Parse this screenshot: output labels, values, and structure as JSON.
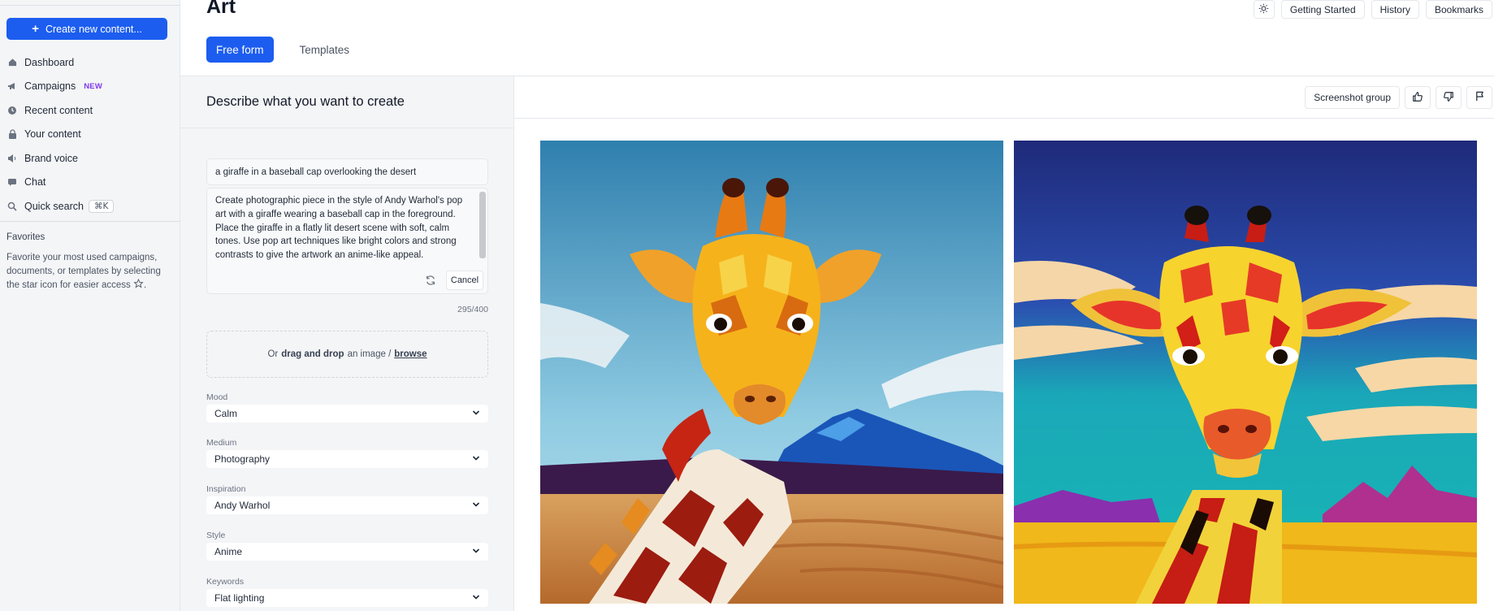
{
  "sidebar": {
    "create_label": "Create new content...",
    "items": [
      {
        "label": "Dashboard",
        "icon": "home-icon"
      },
      {
        "label": "Campaigns",
        "icon": "megaphone-icon",
        "badge": "NEW"
      },
      {
        "label": "Recent content",
        "icon": "clock-icon"
      },
      {
        "label": "Your content",
        "icon": "lock-icon"
      },
      {
        "label": "Brand voice",
        "icon": "speaker-icon"
      },
      {
        "label": "Chat",
        "icon": "chat-icon"
      },
      {
        "label": "Quick search",
        "icon": "search-icon",
        "shortcut": "⌘K"
      }
    ],
    "favorites_title": "Favorites",
    "favorites_text": "Favorite your most used campaigns, documents, or templates by selecting the star icon for easier access"
  },
  "header": {
    "title": "Art",
    "tabs": [
      "Free form",
      "Templates"
    ],
    "actions": [
      "Getting Started",
      "History",
      "Bookmarks"
    ]
  },
  "form": {
    "heading": "Describe what you want to create",
    "prompt": "a giraffe in a baseball cap overlooking the desert",
    "expanded": "Create photographic piece in the style of Andy Warhol's pop art with a giraffe wearing a baseball cap in the foreground. Place the giraffe in a flatly lit desert scene with soft, calm tones. Use pop art techniques like bright colors and strong contrasts to give the artwork an anime-like appeal.",
    "cancel": "Cancel",
    "counter": "295/400",
    "drop": {
      "or": "Or",
      "drag": "drag and drop",
      "mid": "an image /",
      "browse": "browse"
    },
    "fields": [
      {
        "label": "Mood",
        "value": "Calm"
      },
      {
        "label": "Medium",
        "value": "Photography"
      },
      {
        "label": "Inspiration",
        "value": "Andy Warhol"
      },
      {
        "label": "Style",
        "value": "Anime"
      },
      {
        "label": "Keywords",
        "value": "Flat lighting"
      }
    ]
  },
  "results": {
    "screenshot_label": "Screenshot group"
  },
  "colors": {
    "accent": "#1c5df0",
    "badge": "#7c3aed"
  }
}
